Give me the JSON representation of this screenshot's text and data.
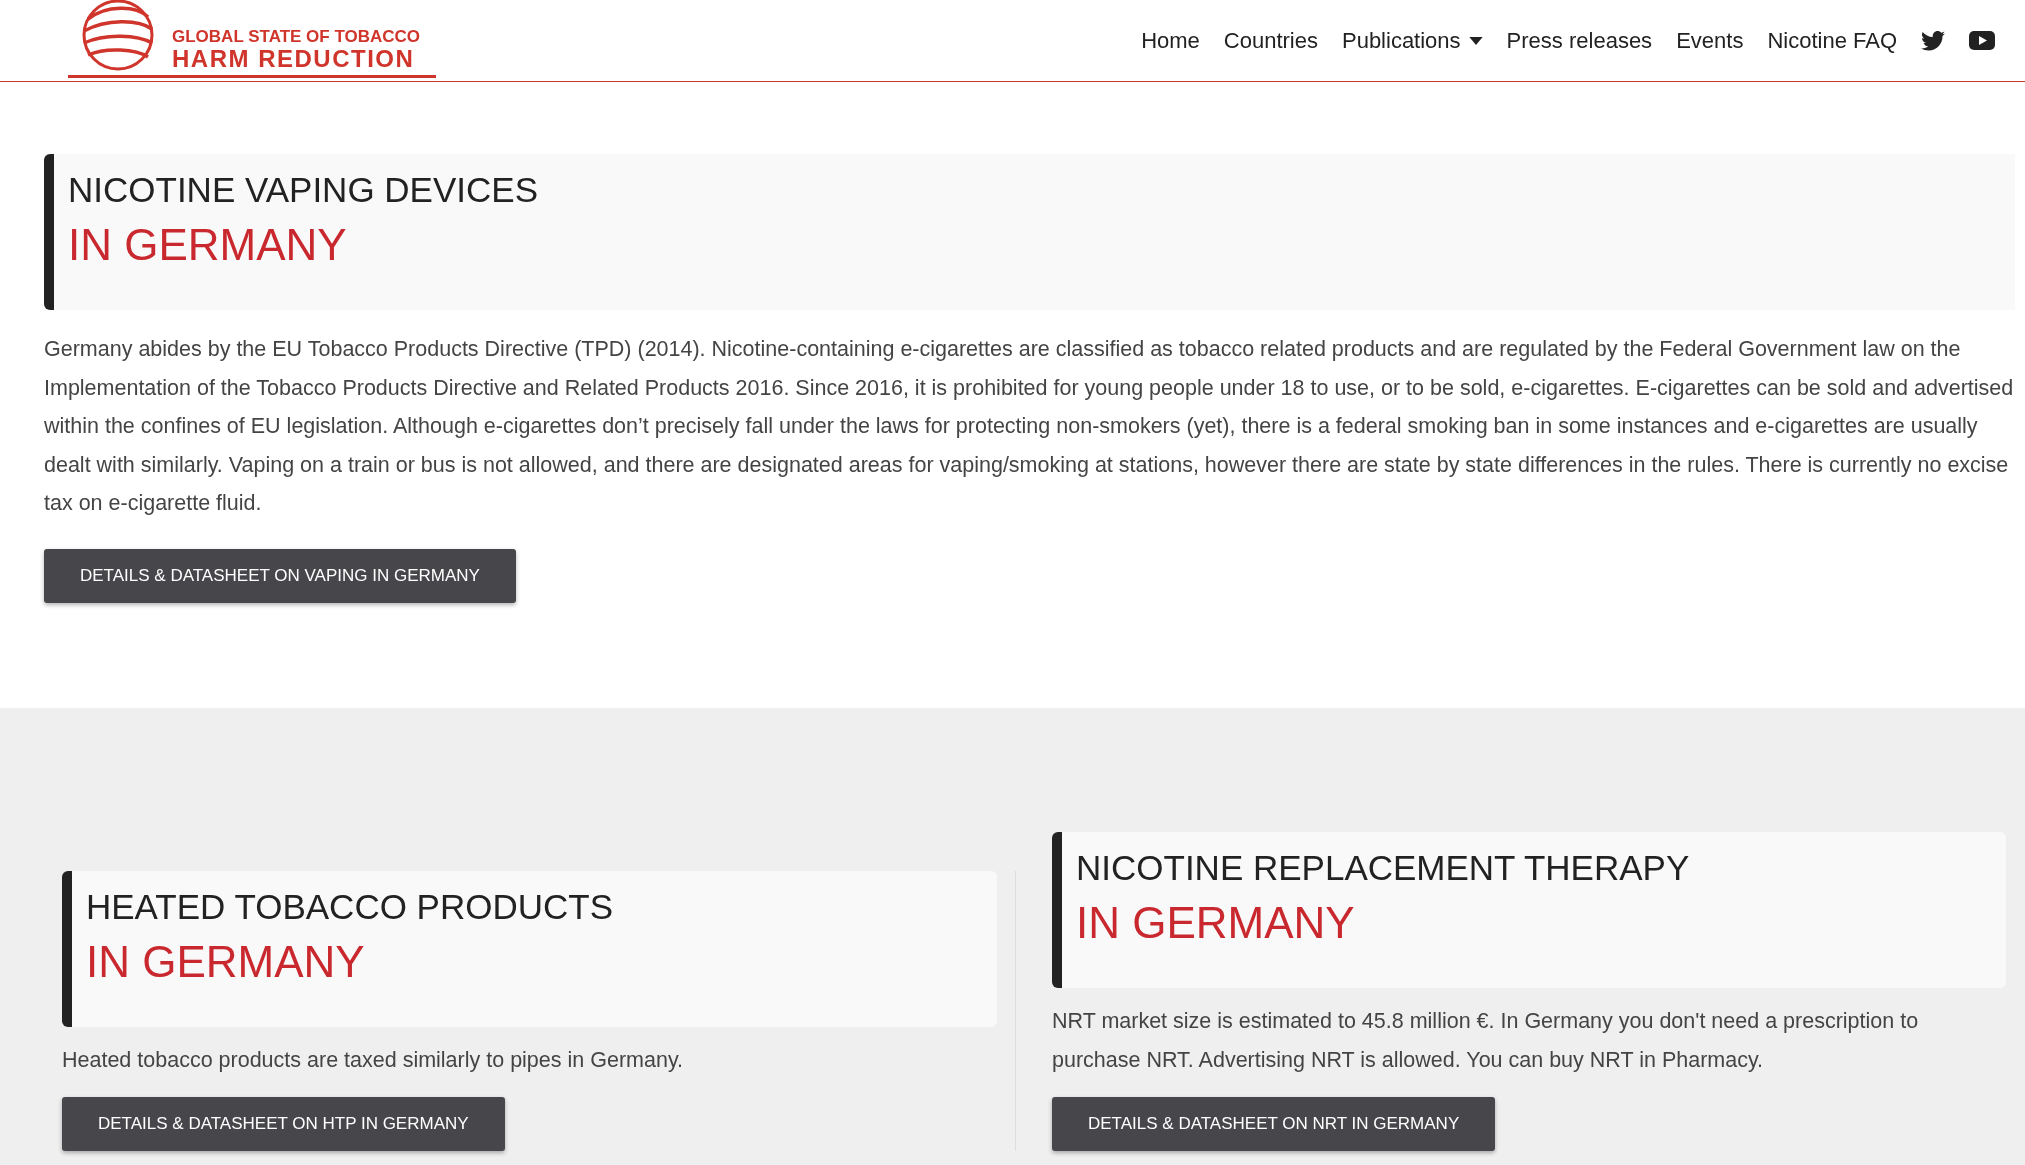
{
  "header": {
    "logo": {
      "line1": "GLOBAL STATE OF TOBACCO",
      "line2": "HARM REDUCTION"
    },
    "nav": [
      {
        "label": "Home",
        "kind": "link"
      },
      {
        "label": "Countries",
        "kind": "link"
      },
      {
        "label": "Publications",
        "kind": "dropdown"
      },
      {
        "label": "Press releases",
        "kind": "link"
      },
      {
        "label": "Events",
        "kind": "link"
      },
      {
        "label": "Nicotine FAQ",
        "kind": "link"
      }
    ]
  },
  "sections": [
    {
      "title": "NICOTINE VAPING DEVICES",
      "subtitle": "IN GERMANY",
      "text": "Germany abides by the EU Tobacco Products Directive (TPD) (2014). Nicotine-containing e-cigarettes are classified as tobacco related products and are regulated by the Federal Government law on the Implementation of the Tobacco Products Directive and Related Products 2016. Since 2016, it is prohibited for young people under 18 to use, or to be sold, e-cigarettes. E-cigarettes can be sold and advertised within the confines of EU legislation. Although e-cigarettes don’t precisely fall under the laws for protecting non-smokers (yet), there is a federal smoking ban in some instances and e-cigarettes are usually dealt with similarly. Vaping on a train or bus is not allowed, and there are designated areas for vaping/smoking at stations, however there are state by state differences in the rules. There is currently no excise tax on e-cigarette fluid.",
      "button": "DETAILS & DATASHEET ON VAPING IN GERMANY"
    },
    {
      "title": "HEATED TOBACCO PRODUCTS",
      "subtitle": "IN GERMANY",
      "text": "Heated tobacco products are taxed similarly to pipes in Germany.",
      "button": "DETAILS & DATASHEET ON HTP IN GERMANY"
    },
    {
      "title": "NICOTINE REPLACEMENT THERAPY",
      "subtitle": "IN GERMANY",
      "text": "NRT market size is estimated to 45.8 million €. In Germany you don't need a prescription to purchase NRT. Advertising NRT is allowed. You can buy NRT in Pharmacy.",
      "button": "DETAILS & DATASHEET ON NRT IN GERMANY"
    }
  ]
}
